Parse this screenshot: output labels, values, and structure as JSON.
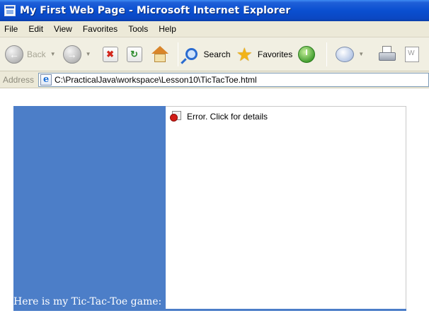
{
  "window": {
    "title": "My First Web Page - Microsoft Internet Explorer"
  },
  "menu": {
    "items": [
      "File",
      "Edit",
      "View",
      "Favorites",
      "Tools",
      "Help"
    ]
  },
  "toolbar": {
    "back_label": "Back",
    "search_label": "Search",
    "favorites_label": "Favorites"
  },
  "address": {
    "label": "Address",
    "url": "C:\\PracticalJava\\workspace\\Lesson10\\TicTacToe.html"
  },
  "page": {
    "applet_status": "Error.  Click for details",
    "caption": "Here is my Tic-Tac-Toe game:",
    "panel_color": "#4c7ec8"
  }
}
